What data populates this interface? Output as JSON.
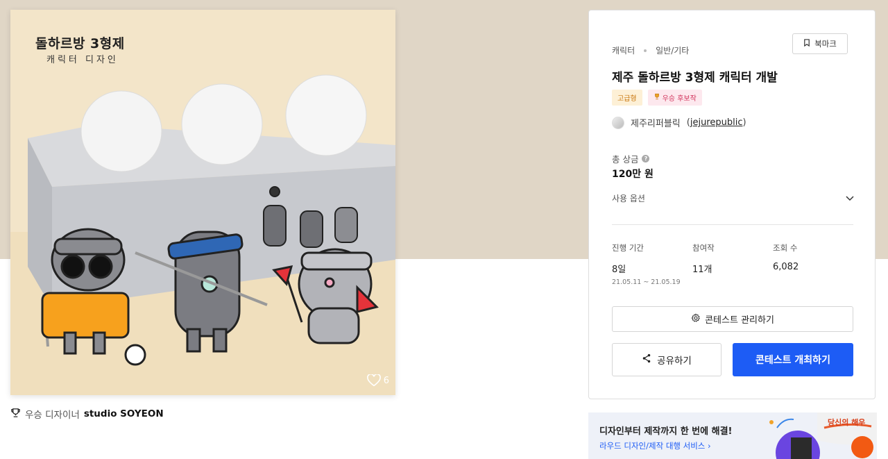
{
  "artwork": {
    "title": "돌하르방 3형제",
    "subtitle": "캐릭터 디자인",
    "like_count": "6"
  },
  "designer": {
    "badge": "우승 디자이너",
    "name": "studio SOYEON"
  },
  "panel": {
    "breadcrumb": [
      "캐릭터",
      "일반/기타"
    ],
    "bookmark_label": "북마크",
    "title": "제주 돌하르방 3형제 캐릭터 개발",
    "tags": {
      "premium": "고급형",
      "award": "우승 후보작"
    },
    "host": {
      "name": "제주리퍼블릭",
      "id": "jejurepublic"
    },
    "prize": {
      "label": "총 상금",
      "value": "120만 원"
    },
    "options_label": "사용 옵션",
    "stats": {
      "period": {
        "label": "진행 기간",
        "value": "8일",
        "dates": "21.05.11 ~ 21.05.19"
      },
      "participants": {
        "label": "참여작",
        "value": "11개"
      },
      "views": {
        "label": "조회 수",
        "value": "6,082"
      }
    },
    "manage_label": "콘테스트 관리하기",
    "share_label": "공유하기",
    "host_contest_label": "콘테스트 개최하기"
  },
  "ad": {
    "title": "디자인부터 제작까지 한 번에 해결!",
    "link": "라우드 디자인/제작 대행 서비스 ›",
    "brand_text": "당신의 해우"
  },
  "colors": {
    "top_band": "#e0d6c6",
    "primary_button": "#1d5cf5",
    "premium_tag": "#c9770f",
    "award_tag": "#d2325b"
  }
}
